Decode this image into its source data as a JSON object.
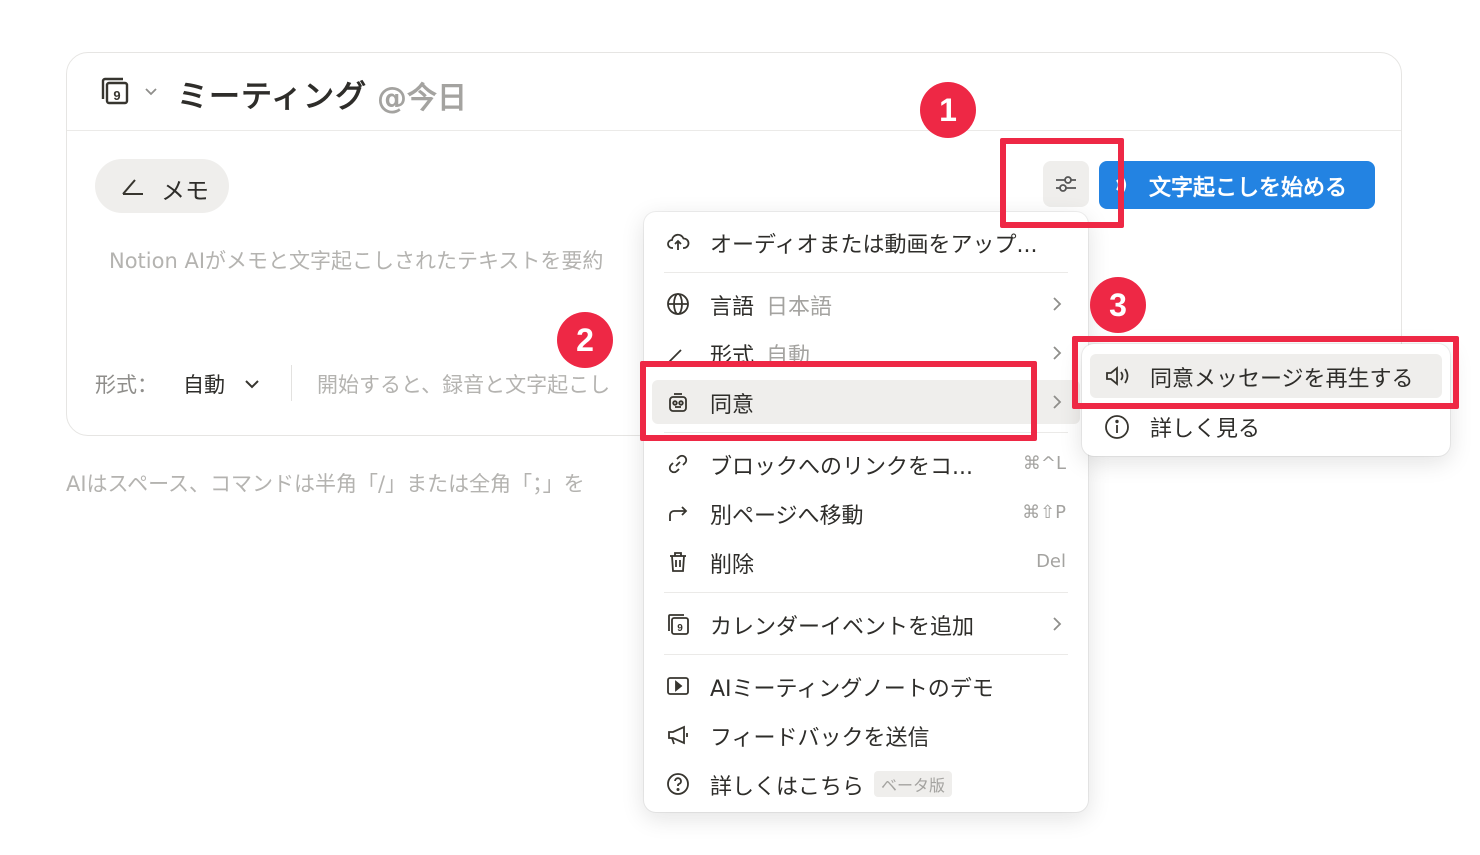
{
  "card": {
    "title": "ミーティング",
    "title_date": "@今日",
    "memo_label": "メモ",
    "summary_placeholder": "Notion AIがメモと文字起こしされたテキストを要約",
    "format_label": "形式：",
    "format_value": "自動",
    "start_hint": "開始すると、録音と文字起こし",
    "transcribe_label": "文字起こしを始める"
  },
  "footer_hint": "AIはスペース、コマンドは半角「/」または全角「；」を",
  "menu": {
    "upload": "オーディオまたは動画をアップ...",
    "language_label": "言語",
    "language_value": "日本語",
    "format_label": "形式",
    "format_value": "自動",
    "consent": "同意",
    "copy_link": "ブロックへのリンクをコ...",
    "copy_link_shortcut": "⌘^L",
    "move": "別ページへ移動",
    "move_shortcut": "⌘⇧P",
    "delete": "削除",
    "delete_shortcut": "Del",
    "add_calendar": "カレンダーイベントを追加",
    "demo": "AIミーティングノートのデモ",
    "feedback": "フィードバックを送信",
    "learn_more": "詳しくはこちら",
    "beta_badge": "ベータ版"
  },
  "submenu": {
    "play_consent": "同意メッセージを再生する",
    "learn_more": "詳しく見る"
  },
  "annotations": {
    "badge_1": "1",
    "badge_2": "2",
    "badge_3": "3",
    "color": "#ee2845"
  },
  "colors": {
    "accent": "#2383e2",
    "hover_bg": "#efeeec"
  }
}
